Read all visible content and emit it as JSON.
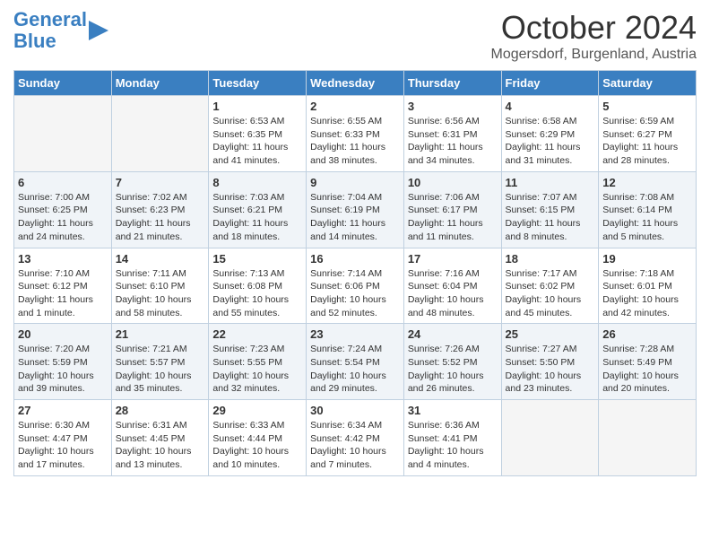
{
  "header": {
    "logo_line1": "General",
    "logo_line2": "Blue",
    "month": "October 2024",
    "location": "Mogersdorf, Burgenland, Austria"
  },
  "days_of_week": [
    "Sunday",
    "Monday",
    "Tuesday",
    "Wednesday",
    "Thursday",
    "Friday",
    "Saturday"
  ],
  "weeks": [
    [
      {
        "day": "",
        "info": ""
      },
      {
        "day": "",
        "info": ""
      },
      {
        "day": "1",
        "info": "Sunrise: 6:53 AM\nSunset: 6:35 PM\nDaylight: 11 hours and 41 minutes."
      },
      {
        "day": "2",
        "info": "Sunrise: 6:55 AM\nSunset: 6:33 PM\nDaylight: 11 hours and 38 minutes."
      },
      {
        "day": "3",
        "info": "Sunrise: 6:56 AM\nSunset: 6:31 PM\nDaylight: 11 hours and 34 minutes."
      },
      {
        "day": "4",
        "info": "Sunrise: 6:58 AM\nSunset: 6:29 PM\nDaylight: 11 hours and 31 minutes."
      },
      {
        "day": "5",
        "info": "Sunrise: 6:59 AM\nSunset: 6:27 PM\nDaylight: 11 hours and 28 minutes."
      }
    ],
    [
      {
        "day": "6",
        "info": "Sunrise: 7:00 AM\nSunset: 6:25 PM\nDaylight: 11 hours and 24 minutes."
      },
      {
        "day": "7",
        "info": "Sunrise: 7:02 AM\nSunset: 6:23 PM\nDaylight: 11 hours and 21 minutes."
      },
      {
        "day": "8",
        "info": "Sunrise: 7:03 AM\nSunset: 6:21 PM\nDaylight: 11 hours and 18 minutes."
      },
      {
        "day": "9",
        "info": "Sunrise: 7:04 AM\nSunset: 6:19 PM\nDaylight: 11 hours and 14 minutes."
      },
      {
        "day": "10",
        "info": "Sunrise: 7:06 AM\nSunset: 6:17 PM\nDaylight: 11 hours and 11 minutes."
      },
      {
        "day": "11",
        "info": "Sunrise: 7:07 AM\nSunset: 6:15 PM\nDaylight: 11 hours and 8 minutes."
      },
      {
        "day": "12",
        "info": "Sunrise: 7:08 AM\nSunset: 6:14 PM\nDaylight: 11 hours and 5 minutes."
      }
    ],
    [
      {
        "day": "13",
        "info": "Sunrise: 7:10 AM\nSunset: 6:12 PM\nDaylight: 11 hours and 1 minute."
      },
      {
        "day": "14",
        "info": "Sunrise: 7:11 AM\nSunset: 6:10 PM\nDaylight: 10 hours and 58 minutes."
      },
      {
        "day": "15",
        "info": "Sunrise: 7:13 AM\nSunset: 6:08 PM\nDaylight: 10 hours and 55 minutes."
      },
      {
        "day": "16",
        "info": "Sunrise: 7:14 AM\nSunset: 6:06 PM\nDaylight: 10 hours and 52 minutes."
      },
      {
        "day": "17",
        "info": "Sunrise: 7:16 AM\nSunset: 6:04 PM\nDaylight: 10 hours and 48 minutes."
      },
      {
        "day": "18",
        "info": "Sunrise: 7:17 AM\nSunset: 6:02 PM\nDaylight: 10 hours and 45 minutes."
      },
      {
        "day": "19",
        "info": "Sunrise: 7:18 AM\nSunset: 6:01 PM\nDaylight: 10 hours and 42 minutes."
      }
    ],
    [
      {
        "day": "20",
        "info": "Sunrise: 7:20 AM\nSunset: 5:59 PM\nDaylight: 10 hours and 39 minutes."
      },
      {
        "day": "21",
        "info": "Sunrise: 7:21 AM\nSunset: 5:57 PM\nDaylight: 10 hours and 35 minutes."
      },
      {
        "day": "22",
        "info": "Sunrise: 7:23 AM\nSunset: 5:55 PM\nDaylight: 10 hours and 32 minutes."
      },
      {
        "day": "23",
        "info": "Sunrise: 7:24 AM\nSunset: 5:54 PM\nDaylight: 10 hours and 29 minutes."
      },
      {
        "day": "24",
        "info": "Sunrise: 7:26 AM\nSunset: 5:52 PM\nDaylight: 10 hours and 26 minutes."
      },
      {
        "day": "25",
        "info": "Sunrise: 7:27 AM\nSunset: 5:50 PM\nDaylight: 10 hours and 23 minutes."
      },
      {
        "day": "26",
        "info": "Sunrise: 7:28 AM\nSunset: 5:49 PM\nDaylight: 10 hours and 20 minutes."
      }
    ],
    [
      {
        "day": "27",
        "info": "Sunrise: 6:30 AM\nSunset: 4:47 PM\nDaylight: 10 hours and 17 minutes."
      },
      {
        "day": "28",
        "info": "Sunrise: 6:31 AM\nSunset: 4:45 PM\nDaylight: 10 hours and 13 minutes."
      },
      {
        "day": "29",
        "info": "Sunrise: 6:33 AM\nSunset: 4:44 PM\nDaylight: 10 hours and 10 minutes."
      },
      {
        "day": "30",
        "info": "Sunrise: 6:34 AM\nSunset: 4:42 PM\nDaylight: 10 hours and 7 minutes."
      },
      {
        "day": "31",
        "info": "Sunrise: 6:36 AM\nSunset: 4:41 PM\nDaylight: 10 hours and 4 minutes."
      },
      {
        "day": "",
        "info": ""
      },
      {
        "day": "",
        "info": ""
      }
    ]
  ]
}
